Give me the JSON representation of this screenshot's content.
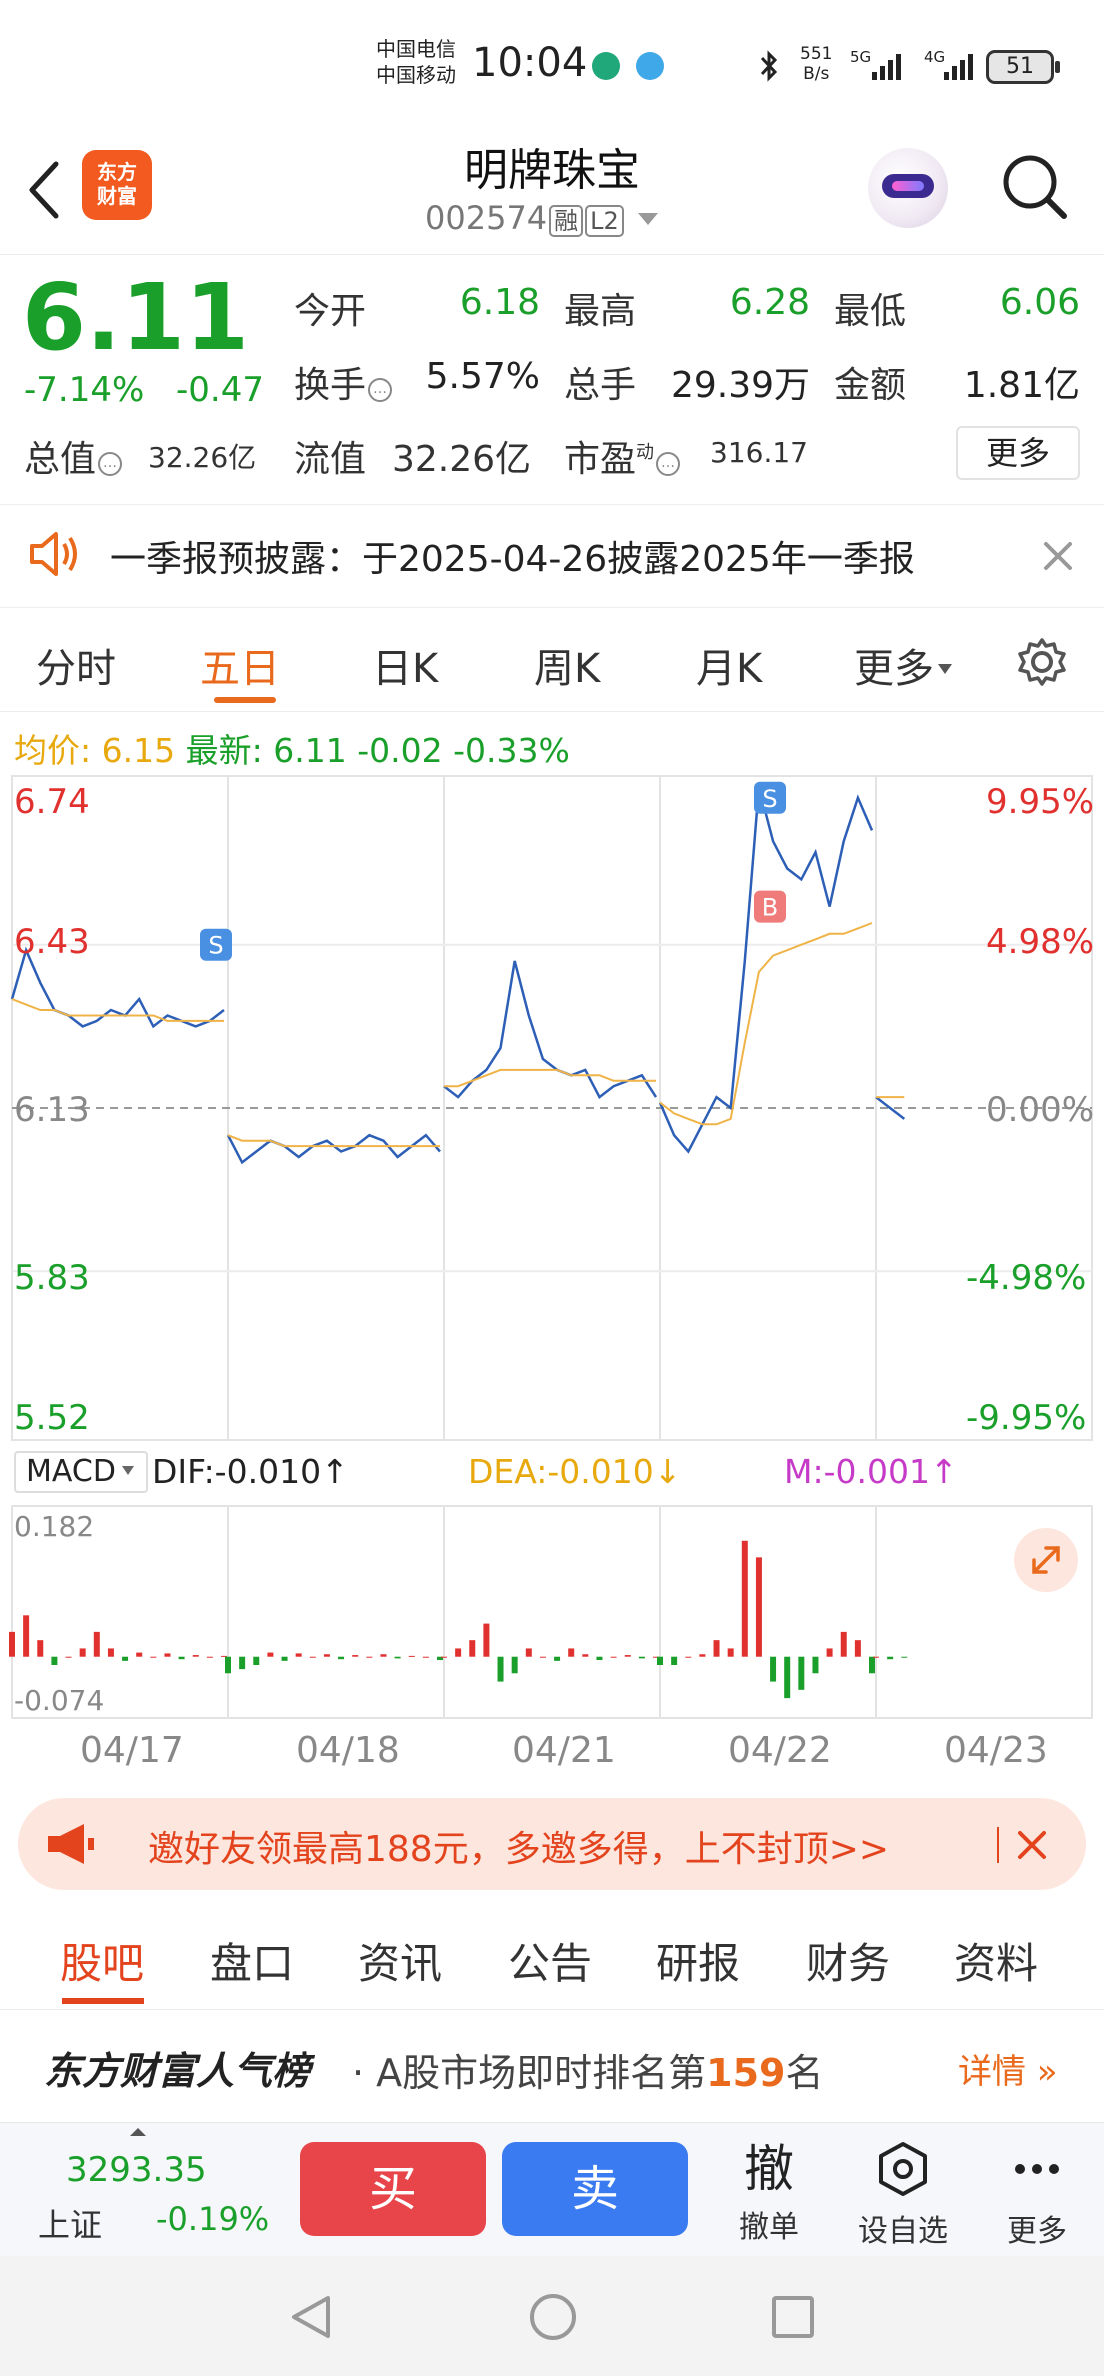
{
  "status_bar": {
    "carrier1": "中国电信",
    "carrier2": "中国移动",
    "time": "10:04",
    "net_speed_value": "551",
    "net_speed_unit": "B/s",
    "signal1": "5G",
    "signal2": "4G",
    "battery": "51"
  },
  "header": {
    "logo_text_line1": "东方",
    "logo_text_line2": "财富",
    "stock_name": "明牌珠宝",
    "stock_code": "002574",
    "tag_margin": "融",
    "tag_level": "L2"
  },
  "quote": {
    "price": "6.11",
    "change_pct": "-7.14%",
    "change_amt": "-0.47",
    "open_label": "今开",
    "open_value": "6.18",
    "high_label": "最高",
    "high_value": "6.28",
    "low_label": "最低",
    "low_value": "6.06",
    "turnover_label": "换手",
    "turnover_value": "5.57%",
    "volume_label": "总手",
    "volume_value": "29.39万",
    "amount_label": "金额",
    "amount_value": "1.81亿",
    "mktcap_label": "总值",
    "mktcap_value": "32.26亿",
    "float_label": "流值",
    "float_value": "32.26亿",
    "pe_label": "市盈",
    "pe_sup": "动",
    "pe_value": "316.17",
    "more_button": "更多"
  },
  "announcement": {
    "text": "一季报预披露：于2025-04-26披露2025年一季报"
  },
  "chart_tabs": {
    "items": [
      "分时",
      "五日",
      "日K",
      "周K",
      "月K",
      "更多"
    ],
    "active": "五日"
  },
  "avg_info": {
    "avg_label": "均价:",
    "avg_value": "6.15",
    "latest_label": "最新:",
    "latest_value": "6.11",
    "chg": "-0.02",
    "chg_pct": "-0.33%"
  },
  "chart_data": {
    "type": "line",
    "title": "五日分时",
    "x_days": [
      "04/17",
      "04/18",
      "04/21",
      "04/22",
      "04/23"
    ],
    "y_ticks_left": [
      "6.74",
      "6.43",
      "6.13",
      "5.83",
      "5.52"
    ],
    "y_ticks_right": [
      "9.95%",
      "4.98%",
      "0.00%",
      "-4.98%",
      "-9.95%"
    ],
    "ylim": [
      5.52,
      6.74
    ],
    "prev_close": 6.13,
    "series": [
      {
        "name": "price",
        "color": "#2d5fb7",
        "values": [
          6.33,
          6.42,
          6.36,
          6.31,
          6.3,
          6.28,
          6.29,
          6.31,
          6.3,
          6.33,
          6.28,
          6.3,
          6.29,
          6.28,
          6.29,
          6.31,
          6.08,
          6.03,
          6.05,
          6.07,
          6.06,
          6.04,
          6.06,
          6.07,
          6.05,
          6.06,
          6.08,
          6.07,
          6.04,
          6.06,
          6.08,
          6.05,
          6.17,
          6.15,
          6.18,
          6.2,
          6.24,
          6.4,
          6.3,
          6.22,
          6.2,
          6.19,
          6.2,
          6.15,
          6.17,
          6.18,
          6.19,
          6.15,
          6.14,
          6.08,
          6.05,
          6.1,
          6.15,
          6.13,
          6.4,
          6.72,
          6.62,
          6.57,
          6.55,
          6.6,
          6.5,
          6.62,
          6.7,
          6.64,
          6.15,
          6.13,
          6.11
        ],
        "markers_sell": [
          {
            "day": "04/17",
            "value": 6.43
          },
          {
            "day": "04/22",
            "value": 6.7
          }
        ],
        "markers_buy": [
          {
            "day": "04/22",
            "value": 6.5
          }
        ]
      },
      {
        "name": "avg",
        "color": "#f0b347",
        "values": [
          6.33,
          6.32,
          6.31,
          6.31,
          6.3,
          6.3,
          6.3,
          6.3,
          6.3,
          6.3,
          6.3,
          6.29,
          6.29,
          6.29,
          6.29,
          6.29,
          6.08,
          6.07,
          6.07,
          6.07,
          6.06,
          6.06,
          6.06,
          6.06,
          6.06,
          6.06,
          6.06,
          6.06,
          6.06,
          6.06,
          6.06,
          6.06,
          6.17,
          6.17,
          6.18,
          6.19,
          6.2,
          6.2,
          6.2,
          6.2,
          6.2,
          6.19,
          6.19,
          6.19,
          6.18,
          6.18,
          6.18,
          6.18,
          6.14,
          6.12,
          6.11,
          6.1,
          6.1,
          6.11,
          6.25,
          6.38,
          6.41,
          6.42,
          6.43,
          6.44,
          6.45,
          6.45,
          6.46,
          6.47,
          6.15,
          6.15,
          6.15
        ]
      }
    ]
  },
  "macd": {
    "selector": "MACD",
    "dif": "DIF:-0.010↑",
    "dea": "DEA:-0.010↓",
    "m": "M:-0.001↑",
    "y_top": "0.182",
    "y_bottom": "-0.074",
    "chart_data": {
      "type": "bar",
      "ylim": [
        -0.074,
        0.182
      ],
      "hist": [
        0.03,
        0.05,
        0.02,
        -0.01,
        0.0,
        0.01,
        0.03,
        0.01,
        -0.005,
        0.005,
        0.0,
        0.004,
        -0.003,
        0.002,
        0.0,
        0.001,
        -0.02,
        -0.015,
        -0.01,
        0.005,
        -0.005,
        0.004,
        0.0,
        0.003,
        -0.003,
        0.002,
        0.0,
        0.003,
        -0.002,
        0.001,
        0.0,
        -0.004,
        0.0,
        0.01,
        0.02,
        0.04,
        -0.03,
        -0.02,
        0.01,
        0.0,
        -0.005,
        0.01,
        0.003,
        -0.004,
        0.0,
        0.002,
        -0.002,
        0.0,
        -0.01,
        -0.01,
        0.0,
        0.003,
        0.02,
        0.01,
        0.14,
        0.12,
        -0.03,
        -0.05,
        -0.04,
        -0.02,
        0.01,
        0.03,
        0.02,
        -0.02,
        0.0,
        -0.003,
        -0.001
      ]
    }
  },
  "promo": {
    "text": "邀好友领最高188元，多邀多得，上不封顶>>"
  },
  "bottom_tabs": {
    "items": [
      "股吧",
      "盘口",
      "资讯",
      "公告",
      "研报",
      "财务",
      "资料"
    ],
    "active": "股吧"
  },
  "popularity": {
    "title": "东方财富人气榜",
    "text_prefix": "· A股市场即时排名第",
    "rank": "159",
    "text_suffix": "名",
    "detail": "详情"
  },
  "trade_bar": {
    "index_value": "3293.35",
    "index_name": "上证",
    "index_change": "-0.19%",
    "buy": "买",
    "sell": "卖",
    "cancel_glyph": "撤",
    "cancel_label": "撤单",
    "watch_label": "设自选",
    "more_label": "更多"
  }
}
